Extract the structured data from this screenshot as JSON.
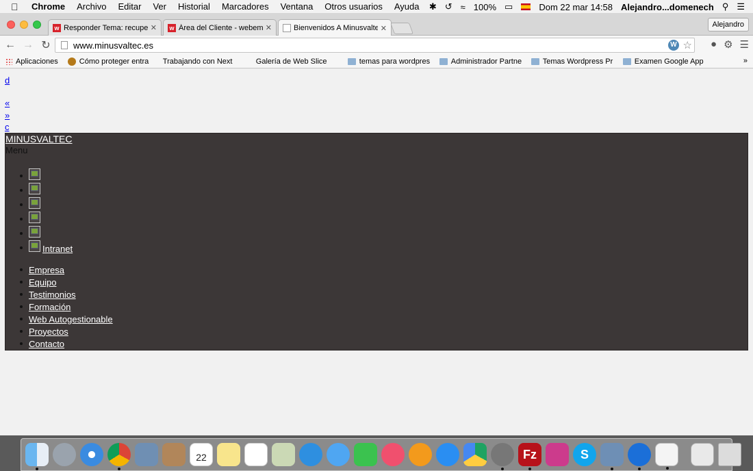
{
  "menubar": {
    "app": "Chrome",
    "items": [
      "Archivo",
      "Editar",
      "Ver",
      "Historial",
      "Marcadores",
      "Ventana",
      "Otros usuarios",
      "Ayuda"
    ],
    "battery": "100%",
    "datetime": "Dom 22 mar  14:58",
    "user": "Alejandro...domenech"
  },
  "browser": {
    "tabs": [
      {
        "title": "Responder Tema: recupera",
        "icon": "webempresa-icon",
        "active": false
      },
      {
        "title": "Área del Cliente - webemp",
        "icon": "webempresa-icon",
        "active": false
      },
      {
        "title": "Bienvenidos A Minusvaltec",
        "icon": "page-icon",
        "active": true
      }
    ],
    "profile_name": "Alejandro",
    "url": "www.minusvaltec.es",
    "bookmarks": [
      {
        "label": "Aplicaciones",
        "icon": "apps-icon"
      },
      {
        "label": "Cómo proteger entra",
        "icon": "coin-icon"
      },
      {
        "label": "Trabajando con Next",
        "icon": "page-icon"
      },
      {
        "label": "Galería de Web Slice",
        "icon": "page-icon"
      },
      {
        "label": "temas para wordpres",
        "icon": "folder-icon"
      },
      {
        "label": "Administrador Partne",
        "icon": "folder-icon"
      },
      {
        "label": "Temas Wordpress Pr",
        "icon": "folder-icon"
      },
      {
        "label": "Examen Google App",
        "icon": "folder-icon"
      }
    ],
    "bookmarks_more": "»"
  },
  "page": {
    "links_top": [
      "d",
      "«",
      "»",
      "c"
    ],
    "brand": "MINUSVALTEC",
    "menu_label": "Menu",
    "icon_items_count": 6,
    "intranet_label": "Intranet",
    "nav": [
      "Empresa",
      "Equipo",
      "Testimonios",
      "Formación",
      "Web Autogestionable",
      "Proyectos",
      "Contacto"
    ],
    "colors": {
      "header_bg": "#3c3737",
      "link": "#0000ee"
    }
  },
  "dock": {
    "apps": [
      "finder",
      "launchpad",
      "safari",
      "chrome",
      "preview",
      "contacts",
      "calendar",
      "notes",
      "reminders",
      "maps",
      "mail",
      "messages",
      "facetime",
      "itunes",
      "ibooks",
      "app-store",
      "google-drive",
      "system-preferences",
      "filezilla",
      "photo-booth",
      "skype",
      "virtualbox",
      "teamviewer",
      "textedit",
      "archive",
      "trash"
    ],
    "calendar_month": "MAR",
    "calendar_day": "22"
  }
}
